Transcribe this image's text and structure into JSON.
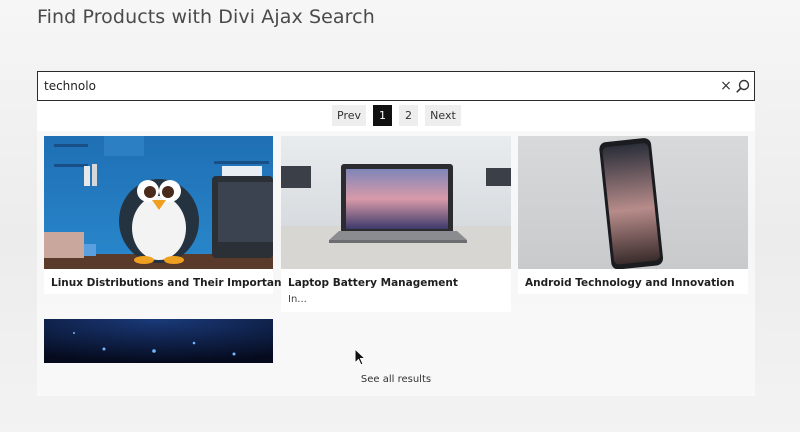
{
  "page": {
    "title": "Find Products with Divi Ajax Search"
  },
  "search": {
    "value": "technolo",
    "clear_symbol": "×"
  },
  "pagination": {
    "prev_label": "Prev",
    "pages": [
      "1",
      "2"
    ],
    "current_page": "1",
    "next_label": "Next"
  },
  "results": [
    {
      "title": "Linux Distributions and Their Importance",
      "excerpt": "",
      "image": "penguin-at-desk-illustration"
    },
    {
      "title": "Laptop Battery Management",
      "excerpt": "In...",
      "image": "laptop-on-desk-photo"
    },
    {
      "title": "Android Technology and Innovation",
      "excerpt": "",
      "image": "smartphone-standing-photo"
    },
    {
      "title": "",
      "excerpt": "",
      "image": "dark-blue-particles-photo"
    }
  ],
  "footer": {
    "see_all_label": "See all results"
  },
  "colors": {
    "active_page_bg": "#111111",
    "page_btn_bg": "#eeeeee",
    "search_border": "#2b2b2b"
  }
}
